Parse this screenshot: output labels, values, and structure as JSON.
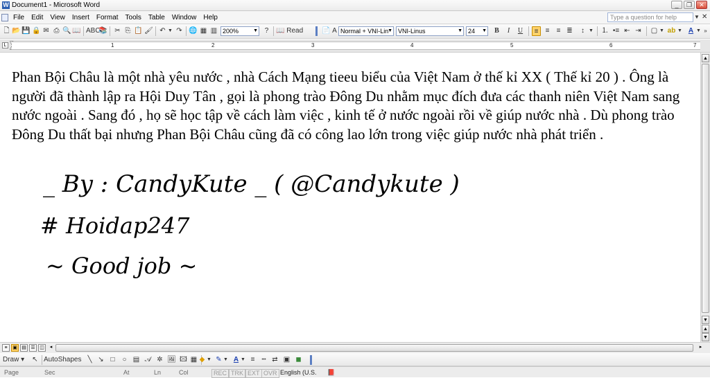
{
  "window": {
    "title": "Document1 - Microsoft Word",
    "controls": [
      "minimize",
      "restore",
      "close"
    ]
  },
  "menubar": {
    "items": [
      "File",
      "Edit",
      "View",
      "Insert",
      "Format",
      "Tools",
      "Table",
      "Window",
      "Help"
    ],
    "help_placeholder": "Type a question for help"
  },
  "toolbar": {
    "zoom": "200%",
    "read_label": "Read",
    "style": "Normal + VNI-Lin",
    "font": "VNI-Linus",
    "font_size": "24",
    "bold": "B",
    "italic": "I",
    "underline": "U",
    "active_alignment": "align-left"
  },
  "ruler": {
    "numbers": [
      "1",
      "2",
      "3",
      "4",
      "5",
      "6",
      "7"
    ]
  },
  "document": {
    "paragraph": "Phan Bội Châu là một nhà yêu nước , nhà Cách Mạng tieeu biểu của Việt Nam ở thế kỉ XX ( Thế kỉ 20 ) . Ông là người đã thành lập ra Hội Duy Tân , gọi là phong trào Đông Du nhằm mục đích đưa các thanh niên Việt Nam sang nước ngoài . Sang đó , họ sẽ học tập về cách làm việc , kinh tế ở nước ngoài rồi về giúp nước nhà . Dù phong trào Đông Du thất bại nhưng Phan Bội Châu cũng đã có công lao lớn trong việc giúp nước nhà phát triển .",
    "signature": "_ By : CandyKute _ ( @Candykute )",
    "hashtag": "# Hoidap247",
    "closing": "~ Good job ~"
  },
  "drawbar": {
    "draw_label": "Draw",
    "autoshapes_label": "AutoShapes"
  },
  "statusbar": {
    "page": "Page",
    "sec": "Sec",
    "at": "At",
    "ln": "Ln",
    "col": "Col",
    "rec": "REC",
    "trk": "TRK",
    "ext": "EXT",
    "ovr": "OVR",
    "language": "English (U.S."
  }
}
